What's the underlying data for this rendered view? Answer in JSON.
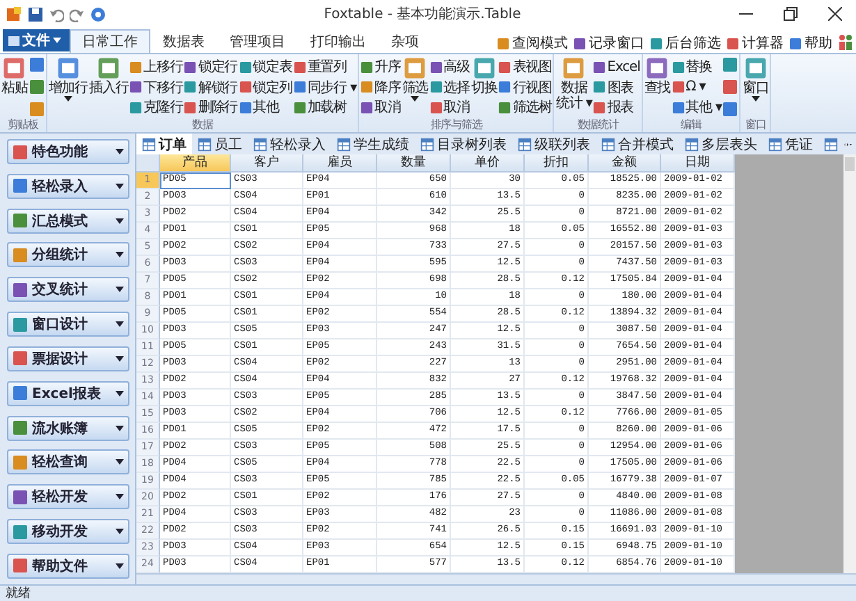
{
  "window": {
    "title": "Foxtable - 基本功能演示.Table"
  },
  "file_menu": {
    "label": "文件"
  },
  "tabs": [
    {
      "label": "日常工作",
      "selected": true
    },
    {
      "label": "数据表",
      "selected": false
    },
    {
      "label": "管理项目",
      "selected": false
    },
    {
      "label": "打印输出",
      "selected": false
    },
    {
      "label": "杂项",
      "selected": false
    }
  ],
  "quick_links": [
    "查阅模式",
    "记录窗口",
    "后台筛选",
    "计算器",
    "帮助"
  ],
  "ribbon": [
    {
      "label": "剪贴板",
      "columns": [
        {
          "kind": "large",
          "items": [
            "粘贴"
          ]
        },
        {
          "kind": "icons"
        }
      ]
    },
    {
      "label": "数据",
      "columns": [
        {
          "kind": "large",
          "items": [
            "增加行"
          ],
          "dropdown": true
        },
        {
          "kind": "large",
          "items": [
            "插入行"
          ]
        },
        {
          "kind": "small",
          "items": [
            "上移行",
            "下移行",
            "克隆行"
          ]
        },
        {
          "kind": "small",
          "items": [
            "锁定行",
            "解锁行",
            "删除行"
          ]
        },
        {
          "kind": "small",
          "items": [
            "锁定表",
            "锁定列",
            "其他"
          ]
        },
        {
          "kind": "small",
          "items": [
            "重置列",
            "同步行 ▾",
            "加载树"
          ]
        }
      ]
    },
    {
      "label": "排序与筛选",
      "columns": [
        {
          "kind": "small",
          "items": [
            "升序",
            "降序",
            "取消"
          ]
        },
        {
          "kind": "large",
          "items": [
            "筛选"
          ],
          "dropdown": true
        },
        {
          "kind": "small",
          "items": [
            "高级",
            "选择",
            "取消"
          ]
        },
        {
          "kind": "large",
          "items": [
            "切换"
          ]
        },
        {
          "kind": "small",
          "items": [
            "表视图",
            "行视图",
            "筛选树"
          ]
        }
      ]
    },
    {
      "label": "数据统计",
      "columns": [
        {
          "kind": "large",
          "items": [
            "数据",
            "统计 ▾"
          ]
        },
        {
          "kind": "small",
          "items": [
            "Excel",
            "图表",
            "报表"
          ]
        }
      ]
    },
    {
      "label": "编辑",
      "columns": [
        {
          "kind": "large",
          "items": [
            "查找"
          ]
        },
        {
          "kind": "small",
          "items": [
            "替换",
            "Ω ▾",
            "其他 ▾"
          ]
        },
        {
          "kind": "icons"
        }
      ]
    },
    {
      "label": "窗口",
      "columns": [
        {
          "kind": "large",
          "items": [
            "窗口"
          ],
          "dropdown": true
        }
      ]
    }
  ],
  "sidebar": [
    "特色功能",
    "轻松录入",
    "汇总模式",
    "分组统计",
    "交叉统计",
    "窗口设计",
    "票据设计",
    "Excel报表",
    "流水账簿",
    "轻松查询",
    "轻松开发",
    "移动开发",
    "帮助文件"
  ],
  "sheet_tabs": [
    {
      "label": "订单",
      "selected": true
    },
    {
      "label": "员工",
      "selected": false
    },
    {
      "label": "轻松录入",
      "selected": false
    },
    {
      "label": "学生成绩",
      "selected": false
    },
    {
      "label": "目录树列表",
      "selected": false
    },
    {
      "label": "级联列表",
      "selected": false
    },
    {
      "label": "合并模式",
      "selected": false
    },
    {
      "label": "多层表头",
      "selected": false
    },
    {
      "label": "凭证",
      "selected": false
    },
    {
      "selected": false
    }
  ],
  "table": {
    "columns": [
      {
        "label": "产品",
        "selected": true
      },
      {
        "label": "客户",
        "selected": false
      },
      {
        "label": "雇员",
        "selected": false
      },
      {
        "label": "数量",
        "selected": false
      },
      {
        "label": "单价",
        "selected": false
      },
      {
        "label": "折扣",
        "selected": false
      },
      {
        "label": "金额",
        "selected": false
      },
      {
        "label": "日期",
        "selected": false
      }
    ],
    "rows": [
      {
        "n": "1",
        "selected": true,
        "cells": [
          "PD05",
          "CS03",
          "EP04",
          "650",
          "30",
          "0.05",
          "18525.00",
          "2009-01-02"
        ]
      },
      {
        "n": "2",
        "selected": false,
        "cells": [
          "PD03",
          "CS04",
          "EP01",
          "610",
          "13.5",
          "0",
          "8235.00",
          "2009-01-02"
        ]
      },
      {
        "n": "3",
        "selected": false,
        "cells": [
          "PD02",
          "CS04",
          "EP04",
          "342",
          "25.5",
          "0",
          "8721.00",
          "2009-01-02"
        ]
      },
      {
        "n": "4",
        "selected": false,
        "cells": [
          "PD01",
          "CS01",
          "EP05",
          "968",
          "18",
          "0.05",
          "16552.80",
          "2009-01-03"
        ]
      },
      {
        "n": "5",
        "selected": false,
        "cells": [
          "PD02",
          "CS02",
          "EP04",
          "733",
          "27.5",
          "0",
          "20157.50",
          "2009-01-03"
        ]
      },
      {
        "n": "6",
        "selected": false,
        "cells": [
          "PD03",
          "CS03",
          "EP04",
          "595",
          "12.5",
          "0",
          "7437.50",
          "2009-01-03"
        ]
      },
      {
        "n": "7",
        "selected": false,
        "cells": [
          "PD05",
          "CS02",
          "EP02",
          "698",
          "28.5",
          "0.12",
          "17505.84",
          "2009-01-04"
        ]
      },
      {
        "n": "8",
        "selected": false,
        "cells": [
          "PD01",
          "CS01",
          "EP04",
          "10",
          "18",
          "0",
          "180.00",
          "2009-01-04"
        ]
      },
      {
        "n": "9",
        "selected": false,
        "cells": [
          "PD05",
          "CS01",
          "EP02",
          "554",
          "28.5",
          "0.12",
          "13894.32",
          "2009-01-04"
        ]
      },
      {
        "n": "10",
        "selected": false,
        "cells": [
          "PD03",
          "CS05",
          "EP03",
          "247",
          "12.5",
          "0",
          "3087.50",
          "2009-01-04"
        ]
      },
      {
        "n": "11",
        "selected": false,
        "cells": [
          "PD05",
          "CS01",
          "EP05",
          "243",
          "31.5",
          "0",
          "7654.50",
          "2009-01-04"
        ]
      },
      {
        "n": "12",
        "selected": false,
        "cells": [
          "PD03",
          "CS04",
          "EP02",
          "227",
          "13",
          "0",
          "2951.00",
          "2009-01-04"
        ]
      },
      {
        "n": "13",
        "selected": false,
        "cells": [
          "PD02",
          "CS04",
          "EP04",
          "832",
          "27",
          "0.12",
          "19768.32",
          "2009-01-04"
        ]
      },
      {
        "n": "14",
        "selected": false,
        "cells": [
          "PD03",
          "CS03",
          "EP05",
          "285",
          "13.5",
          "0",
          "3847.50",
          "2009-01-04"
        ]
      },
      {
        "n": "15",
        "selected": false,
        "cells": [
          "PD03",
          "CS02",
          "EP04",
          "706",
          "12.5",
          "0.12",
          "7766.00",
          "2009-01-05"
        ]
      },
      {
        "n": "16",
        "selected": false,
        "cells": [
          "PD01",
          "CS05",
          "EP02",
          "472",
          "17.5",
          "0",
          "8260.00",
          "2009-01-06"
        ]
      },
      {
        "n": "17",
        "selected": false,
        "cells": [
          "PD02",
          "CS03",
          "EP05",
          "508",
          "25.5",
          "0",
          "12954.00",
          "2009-01-06"
        ]
      },
      {
        "n": "18",
        "selected": false,
        "cells": [
          "PD04",
          "CS05",
          "EP04",
          "778",
          "22.5",
          "0",
          "17505.00",
          "2009-01-06"
        ]
      },
      {
        "n": "19",
        "selected": false,
        "cells": [
          "PD04",
          "CS03",
          "EP05",
          "785",
          "22.5",
          "0.05",
          "16779.38",
          "2009-01-07"
        ]
      },
      {
        "n": "20",
        "selected": false,
        "cells": [
          "PD02",
          "CS01",
          "EP02",
          "176",
          "27.5",
          "0",
          "4840.00",
          "2009-01-08"
        ]
      },
      {
        "n": "21",
        "selected": false,
        "cells": [
          "PD04",
          "CS03",
          "EP03",
          "482",
          "23",
          "0",
          "11086.00",
          "2009-01-08"
        ]
      },
      {
        "n": "22",
        "selected": false,
        "cells": [
          "PD02",
          "CS03",
          "EP02",
          "741",
          "26.5",
          "0.15",
          "16691.03",
          "2009-01-10"
        ]
      },
      {
        "n": "23",
        "selected": false,
        "cells": [
          "PD03",
          "CS04",
          "EP03",
          "654",
          "12.5",
          "0.15",
          "6948.75",
          "2009-01-10"
        ]
      },
      {
        "n": "24",
        "selected": false,
        "cells": [
          "PD03",
          "CS04",
          "EP01",
          "577",
          "13.5",
          "0.12",
          "6854.76",
          "2009-01-10"
        ]
      }
    ]
  },
  "status_bar": "就绪"
}
